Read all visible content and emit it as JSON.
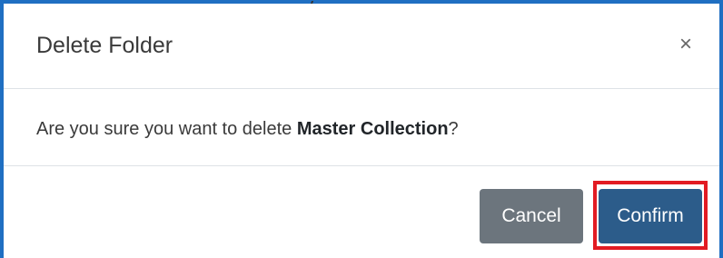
{
  "modal": {
    "title": "Delete Folder",
    "close_label": "×",
    "message_prefix": "Are you sure you want to delete ",
    "message_target": "Master Collection",
    "message_suffix": "?",
    "cancel_label": "Cancel",
    "confirm_label": "Confirm"
  },
  "colors": {
    "window_border": "#1f6fc2",
    "cancel_button": "#6c757d",
    "confirm_button": "#2c5c8a",
    "highlight_outline": "#e21b23"
  }
}
